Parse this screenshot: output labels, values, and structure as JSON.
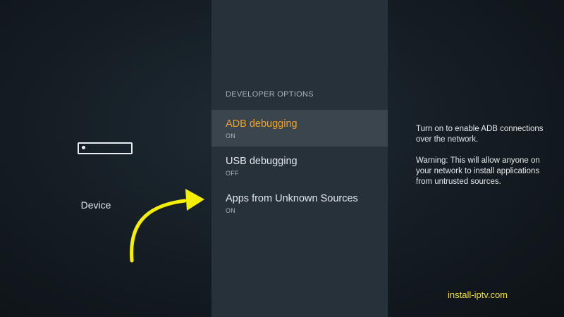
{
  "sidebar": {
    "selected_label": "Device",
    "device_icon": "tv-device-icon"
  },
  "menu": {
    "header": "DEVELOPER OPTIONS",
    "items": [
      {
        "label": "ADB debugging",
        "value": "ON",
        "selected": true
      },
      {
        "label": "USB debugging",
        "value": "OFF",
        "selected": false
      },
      {
        "label": "Apps from Unknown Sources",
        "value": "ON",
        "selected": false
      }
    ]
  },
  "description": {
    "line1": "Turn on to enable ADB connections over the network.",
    "line2": "Warning: This will allow anyone on your network to install applications from untrusted sources."
  },
  "annotation": {
    "arrow_icon": "curved-arrow-icon",
    "arrow_color": "#f5f000"
  },
  "watermark": "install-iptv.com",
  "colors": {
    "accent": "#f0a32c",
    "panel": "#263139",
    "selected_row": "#3a454d"
  }
}
